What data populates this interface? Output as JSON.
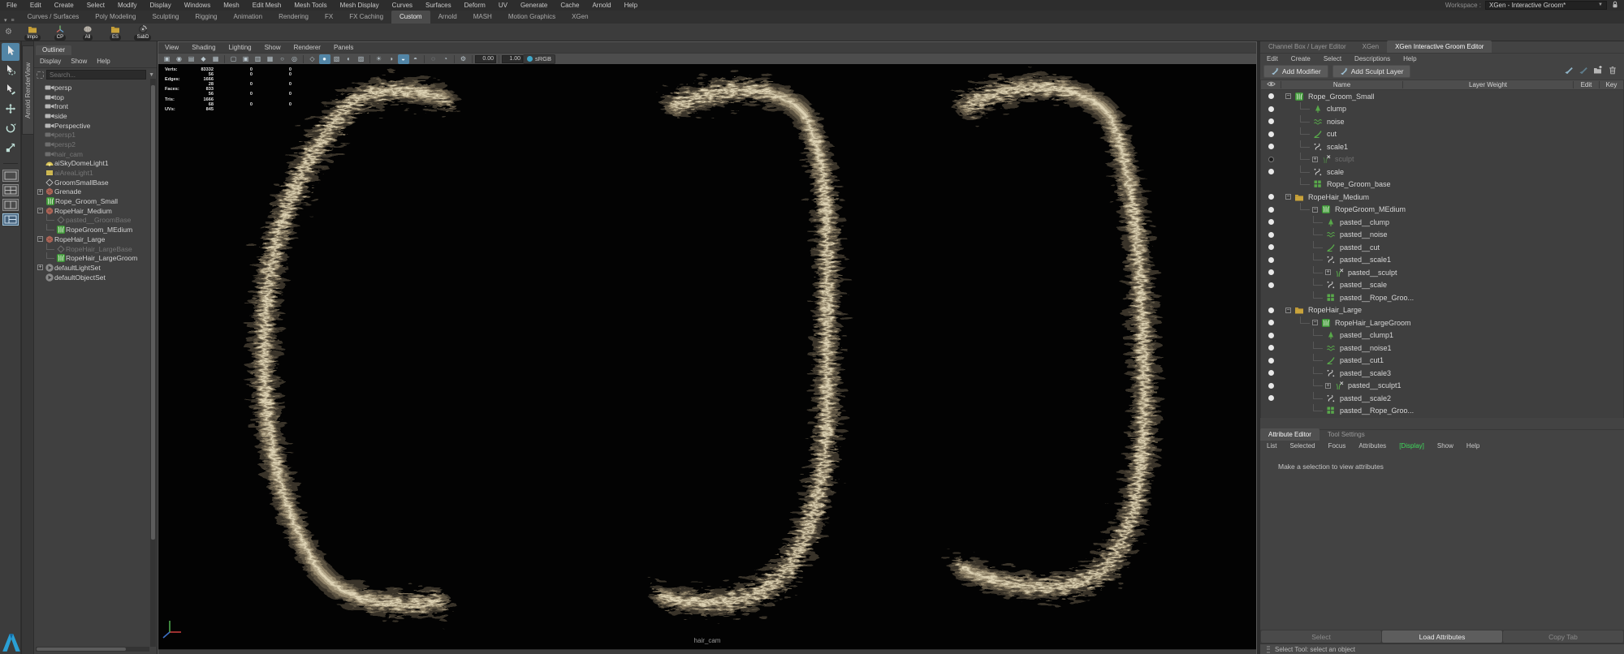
{
  "menubar": {
    "items": [
      "File",
      "Edit",
      "Create",
      "Select",
      "Modify",
      "Display",
      "Windows",
      "Mesh",
      "Edit Mesh",
      "Mesh Tools",
      "Mesh Display",
      "Curves",
      "Surfaces",
      "Deform",
      "UV",
      "Generate",
      "Cache",
      "Arnold",
      "Help"
    ],
    "workspace_label": "Workspace :",
    "workspace_value": "XGen - Interactive Groom*"
  },
  "shelf": {
    "tabs": [
      "Curves / Surfaces",
      "Poly Modeling",
      "Sculpting",
      "Rigging",
      "Animation",
      "Rendering",
      "FX",
      "FX Caching",
      "Custom",
      "Arnold",
      "MASH",
      "Motion Graphics",
      "XGen"
    ],
    "active_tab": "Custom",
    "buttons": [
      {
        "label": "Impo",
        "icon": "folder"
      },
      {
        "label": "CP",
        "icon": "axis"
      },
      {
        "label": "All",
        "icon": "brain"
      },
      {
        "label": "ES",
        "icon": "folder"
      },
      {
        "label": "SabD",
        "icon": "turntable"
      }
    ]
  },
  "toolbox": {
    "tools": [
      {
        "name": "select-tool",
        "active": true
      },
      {
        "name": "lasso-select-tool",
        "active": false
      },
      {
        "name": "paint-select-tool",
        "active": false
      },
      {
        "name": "move-tool",
        "active": false
      },
      {
        "name": "rotate-tool",
        "active": false
      },
      {
        "name": "scale-tool",
        "active": false
      }
    ],
    "layouts": [
      {
        "name": "single-pane-layout",
        "active": false
      },
      {
        "name": "four-pane-layout",
        "active": false
      },
      {
        "name": "two-pane-layout",
        "active": false
      },
      {
        "name": "custom-pane-layout",
        "active": true
      }
    ]
  },
  "side_tab": {
    "label": "Arnold RenderView"
  },
  "outliner": {
    "tab": "Outliner",
    "menus": [
      "Display",
      "Show",
      "Help"
    ],
    "search_placeholder": "Search...",
    "items": [
      {
        "label": "persp",
        "icon": "camera"
      },
      {
        "label": "top",
        "icon": "camera"
      },
      {
        "label": "front",
        "icon": "camera"
      },
      {
        "label": "side",
        "icon": "camera"
      },
      {
        "label": "Perspective",
        "icon": "camera"
      },
      {
        "label": "persp1",
        "icon": "camera",
        "dimmed": true
      },
      {
        "label": "persp2",
        "icon": "camera",
        "dimmed": true
      },
      {
        "label": "hair_cam",
        "icon": "camera",
        "dimmed": true
      },
      {
        "label": "aiSkyDomeLight1",
        "icon": "skydome"
      },
      {
        "label": "aiAreaLight1",
        "icon": "arealight",
        "dimmed": true
      },
      {
        "label": "GroomSmallBase",
        "icon": "diamond"
      },
      {
        "label": "Grenade",
        "icon": "mesh",
        "expander": "plus"
      },
      {
        "label": "Rope_Groom_Small",
        "icon": "xgen",
        "depth": 1
      },
      {
        "label": "RopeHair_Medium",
        "icon": "mesh",
        "expander": "minus"
      },
      {
        "label": "pasted__GroomBase",
        "icon": "diamond",
        "depth": 1,
        "dimmed": true,
        "connector": true
      },
      {
        "label": "RopeGroom_MEdium",
        "icon": "xgen",
        "depth": 1,
        "connector": true
      },
      {
        "label": "RopeHair_Large",
        "icon": "mesh",
        "expander": "minus"
      },
      {
        "label": "RopeHair_LargeBase",
        "icon": "diamond",
        "depth": 1,
        "dimmed": true,
        "connector": true
      },
      {
        "label": "RopeHair_LargeGroom",
        "icon": "xgen",
        "depth": 1,
        "connector": true
      },
      {
        "label": "defaultLightSet",
        "icon": "set",
        "expander": "plus"
      },
      {
        "label": "defaultObjectSet",
        "icon": "set"
      }
    ]
  },
  "viewport": {
    "menus": [
      "View",
      "Shading",
      "Lighting",
      "Show",
      "Renderer",
      "Panels"
    ],
    "toolbar_icons": [
      {
        "name": "select-camera",
        "g": "▣"
      },
      {
        "name": "lock-camera",
        "g": "◉"
      },
      {
        "name": "camera-attributes",
        "g": "▤"
      },
      {
        "name": "bookmark",
        "g": "◆"
      },
      {
        "name": "image-plane",
        "g": "▦"
      },
      {
        "name": "sep"
      },
      {
        "name": "film-gate",
        "g": "▢"
      },
      {
        "name": "resolution-gate",
        "g": "▣"
      },
      {
        "name": "gate-mask",
        "g": "▥"
      },
      {
        "name": "field-chart",
        "g": "▦"
      },
      {
        "name": "safe-action",
        "g": "○"
      },
      {
        "name": "safe-title",
        "g": "◎"
      },
      {
        "name": "sep"
      },
      {
        "name": "wireframe",
        "g": "◇"
      },
      {
        "name": "smooth-shade",
        "g": "●",
        "hl": true
      },
      {
        "name": "textured",
        "g": "▧"
      },
      {
        "name": "use-default-material",
        "g": "◐"
      },
      {
        "name": "wireframe-on-shaded",
        "g": "▨"
      },
      {
        "name": "sep"
      },
      {
        "name": "lighting-all",
        "g": "☀"
      },
      {
        "name": "shadows",
        "g": "◑"
      },
      {
        "name": "screen-space-ao",
        "g": "◒",
        "hl": true
      },
      {
        "name": "motion-blur",
        "g": "◓"
      },
      {
        "name": "sep"
      },
      {
        "name": "isolate-select",
        "g": "◌"
      },
      {
        "name": "xray",
        "g": "◔"
      },
      {
        "name": "sep"
      },
      {
        "name": "exposure-reset",
        "g": "⚙"
      }
    ],
    "exposure": "0.00",
    "gamma": "1.00",
    "colorspace": "sRGB",
    "camera": "hair_cam",
    "hud": [
      [
        "Verts:",
        "83332",
        "0",
        "0"
      ],
      [
        "",
        "56",
        "0",
        "0"
      ],
      [
        "Edges:",
        "1666",
        "",
        ""
      ],
      [
        "",
        "28",
        "0",
        "0"
      ],
      [
        "Faces:",
        "833",
        "",
        ""
      ],
      [
        "",
        "56",
        "0",
        "0"
      ],
      [
        "Tris:",
        "1666",
        "",
        ""
      ],
      [
        "",
        "68",
        "0",
        "0"
      ],
      [
        "UVs:",
        "845",
        "",
        ""
      ]
    ]
  },
  "xgen": {
    "tabs": [
      "Channel Box / Layer Editor",
      "XGen",
      "XGen Interactive Groom Editor"
    ],
    "active_tab": "XGen Interactive Groom Editor",
    "menus": [
      "Edit",
      "Create",
      "Select",
      "Descriptions",
      "Help"
    ],
    "add_modifier_label": "Add Modifier",
    "add_sculpt_layer_label": "Add Sculpt Layer",
    "toolbar_icons": [
      "show-brush",
      "hide-brush",
      "add-folder",
      "delete"
    ],
    "columns": [
      "Name",
      "Layer Weight",
      "Edit",
      "Key"
    ],
    "rows": [
      {
        "label": "Rope_Groom_Small",
        "icon": "xgen",
        "depth": 0,
        "expander": "minus",
        "dot": "on"
      },
      {
        "label": "clump",
        "icon": "clump",
        "depth": 1,
        "dot": "on"
      },
      {
        "label": "noise",
        "icon": "noise",
        "depth": 1,
        "dot": "on"
      },
      {
        "label": "cut",
        "icon": "cut",
        "depth": 1,
        "dot": "on"
      },
      {
        "label": "scale1",
        "icon": "scale",
        "depth": 1,
        "dot": "on"
      },
      {
        "label": "sculpt",
        "icon": "sculpt",
        "depth": 1,
        "expander": "plus",
        "dot": "off",
        "dimmed": true
      },
      {
        "label": "scale",
        "icon": "scale",
        "depth": 1,
        "dot": "on"
      },
      {
        "label": "Rope_Groom_base",
        "icon": "grid",
        "depth": 1
      },
      {
        "label": "RopeHair_Medium",
        "icon": "folder",
        "depth": 0,
        "expander": "minus",
        "dot": "on"
      },
      {
        "label": "RopeGroom_MEdium",
        "icon": "xgen",
        "depth": 1,
        "expander": "minus",
        "dot": "on"
      },
      {
        "label": "pasted__clump",
        "icon": "clump",
        "depth": 2,
        "dot": "on"
      },
      {
        "label": "pasted__noise",
        "icon": "noise",
        "depth": 2,
        "dot": "on"
      },
      {
        "label": "pasted__cut",
        "icon": "cut",
        "depth": 2,
        "dot": "on"
      },
      {
        "label": "pasted__scale1",
        "icon": "scale",
        "depth": 2,
        "dot": "on"
      },
      {
        "label": "pasted__sculpt",
        "icon": "sculpt",
        "depth": 2,
        "expander": "plus",
        "dot": "on"
      },
      {
        "label": "pasted__scale",
        "icon": "scale",
        "depth": 2,
        "dot": "on"
      },
      {
        "label": "pasted__Rope_Groo...",
        "icon": "grid",
        "depth": 2
      },
      {
        "label": "RopeHair_Large",
        "icon": "folder",
        "depth": 0,
        "expander": "minus",
        "dot": "on"
      },
      {
        "label": "RopeHair_LargeGroom",
        "icon": "xgen",
        "depth": 1,
        "expander": "minus",
        "dot": "on"
      },
      {
        "label": "pasted__clump1",
        "icon": "clump",
        "depth": 2,
        "dot": "on"
      },
      {
        "label": "pasted__noise1",
        "icon": "noise",
        "depth": 2,
        "dot": "on"
      },
      {
        "label": "pasted__cut1",
        "icon": "cut",
        "depth": 2,
        "dot": "on"
      },
      {
        "label": "pasted__scale3",
        "icon": "scale",
        "depth": 2,
        "dot": "on"
      },
      {
        "label": "pasted__sculpt1",
        "icon": "sculpt",
        "depth": 2,
        "expander": "plus",
        "dot": "on"
      },
      {
        "label": "pasted__scale2",
        "icon": "scale",
        "depth": 2,
        "dot": "on"
      },
      {
        "label": "pasted__Rope_Groo...",
        "icon": "grid",
        "depth": 2
      }
    ]
  },
  "attribute_editor": {
    "tabs": [
      "Attribute Editor",
      "Tool Settings"
    ],
    "active_tab": "Attribute Editor",
    "menus": [
      "List",
      "Selected",
      "Focus",
      "Attributes",
      "[Display]",
      "Show",
      "Help"
    ],
    "green_menu": "[Display]",
    "message": "Make a selection to view attributes",
    "buttons": [
      "Select",
      "Load Attributes",
      "Copy Tab"
    ],
    "active_button": "Load Attributes",
    "status": "Select Tool: select an object"
  },
  "colors": {
    "accent_blue": "#5285a6",
    "xgen_green": "#3f9638",
    "display_green": "#3fd95b",
    "rope_light": "#cfc3a5",
    "rope_mid": "#8f8268",
    "panel_bg": "#434343"
  }
}
